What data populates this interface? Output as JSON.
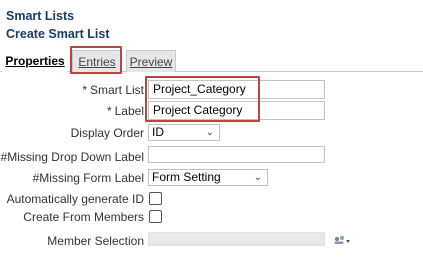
{
  "header": {
    "title": "Smart Lists",
    "subtitle": "Create Smart List"
  },
  "tabs": [
    {
      "label": "Properties",
      "selected": true
    },
    {
      "label": "Entries",
      "selected": false
    },
    {
      "label": "Preview",
      "selected": false
    }
  ],
  "form": {
    "smart_list": {
      "label": "Smart List",
      "required_marker": "*",
      "value": "Project_Category"
    },
    "label_field": {
      "label": "Label",
      "required_marker": "*",
      "value": "Project Category"
    },
    "display_order": {
      "label": "Display Order",
      "selected": "ID"
    },
    "missing_dropdown_label": {
      "label": "#Missing Drop Down Label",
      "value": ""
    },
    "missing_form_label": {
      "label": "#Missing Form Label",
      "selected": "Form Setting"
    },
    "auto_generate_id": {
      "label": "Automatically generate ID",
      "checked": false
    },
    "create_from_members": {
      "label": "Create From Members",
      "checked": false
    },
    "member_selection": {
      "label": "Member Selection",
      "value": ""
    }
  },
  "icons": {
    "dropdown": "chevron-down-icon",
    "member_selector": "member-selector-icon"
  },
  "colors": {
    "title": "#1a3d66",
    "highlight": "#b8483e",
    "tab_inactive": "#e6e6e6"
  }
}
